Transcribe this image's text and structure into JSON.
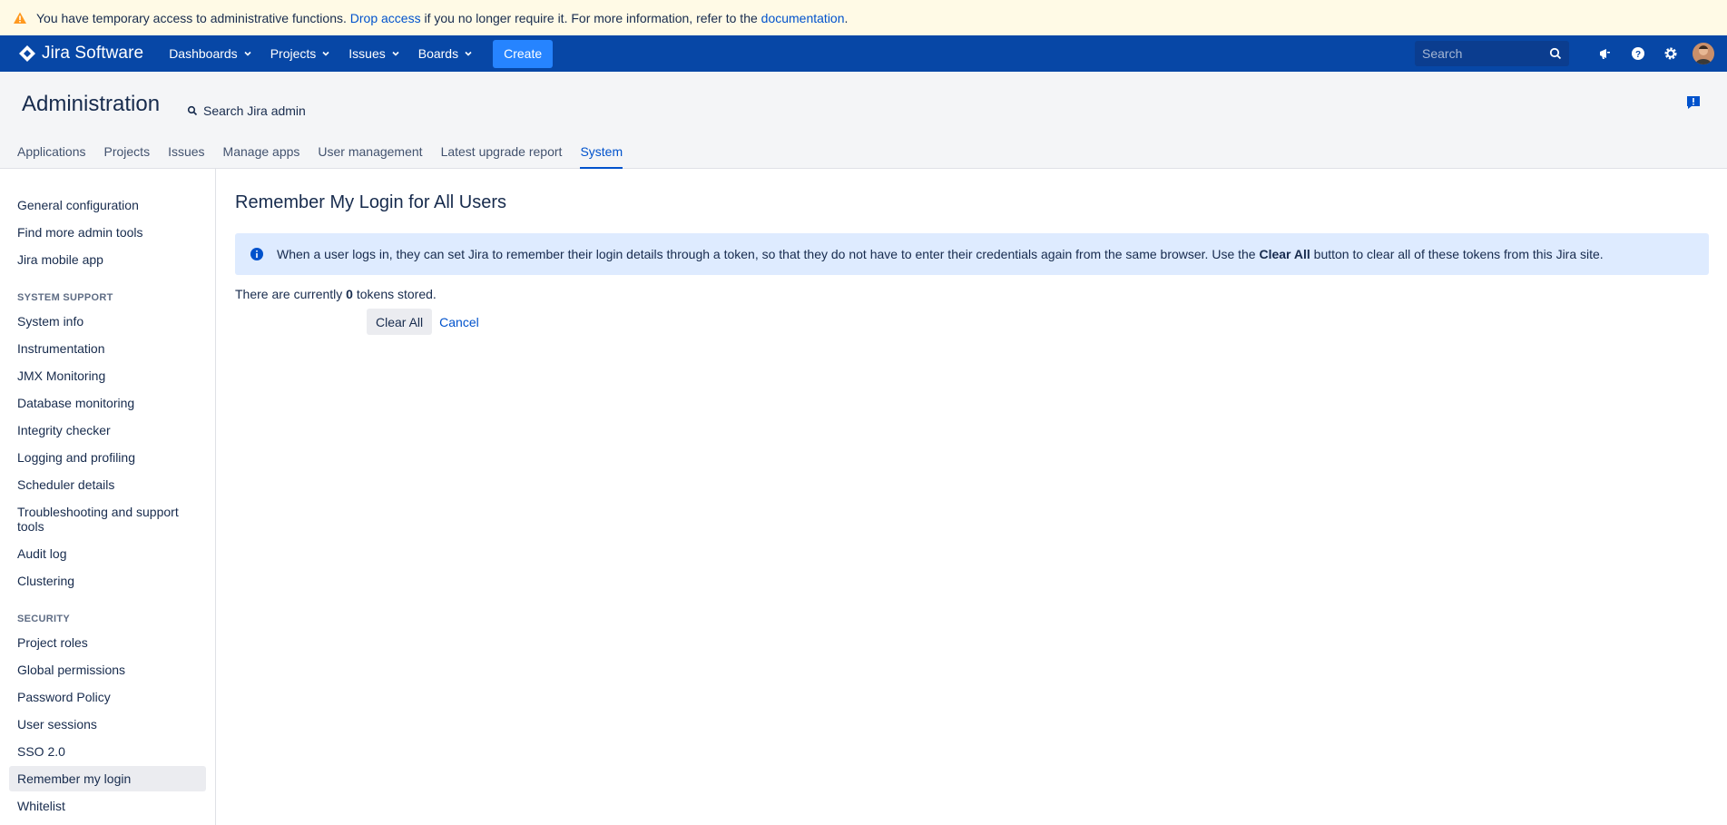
{
  "banner": {
    "text_before": "You have temporary access to administrative functions.",
    "drop_access_link": "Drop access",
    "text_middle": "if you no longer require it. For more information, refer to the",
    "documentation_link": "documentation",
    "text_after": ".",
    "icon": "warning-icon"
  },
  "topnav": {
    "logo_text": "Jira Software",
    "items": [
      {
        "label": "Dashboards"
      },
      {
        "label": "Projects"
      },
      {
        "label": "Issues"
      },
      {
        "label": "Boards"
      }
    ],
    "create_label": "Create",
    "search_placeholder": "Search",
    "icons": [
      "notifications-icon",
      "help-icon",
      "settings-icon"
    ],
    "colors": {
      "bar": "#0747a6",
      "create": "#2684ff"
    }
  },
  "admin": {
    "title": "Administration",
    "search_label": "Search Jira admin",
    "tabs": [
      {
        "label": "Applications"
      },
      {
        "label": "Projects"
      },
      {
        "label": "Issues"
      },
      {
        "label": "Manage apps"
      },
      {
        "label": "User management"
      },
      {
        "label": "Latest upgrade report"
      },
      {
        "label": "System"
      }
    ],
    "active_tab": "System"
  },
  "sidebar": {
    "top_items": [
      {
        "label": "General configuration"
      },
      {
        "label": "Find more admin tools"
      },
      {
        "label": "Jira mobile app"
      }
    ],
    "system_support_heading": "SYSTEM SUPPORT",
    "system_support_items": [
      {
        "label": "System info"
      },
      {
        "label": "Instrumentation"
      },
      {
        "label": "JMX Monitoring"
      },
      {
        "label": "Database monitoring"
      },
      {
        "label": "Integrity checker"
      },
      {
        "label": "Logging and profiling"
      },
      {
        "label": "Scheduler details"
      },
      {
        "label": "Troubleshooting and support tools"
      },
      {
        "label": "Audit log"
      },
      {
        "label": "Clustering"
      }
    ],
    "security_heading": "SECURITY",
    "security_items": [
      {
        "label": "Project roles"
      },
      {
        "label": "Global permissions"
      },
      {
        "label": "Password Policy"
      },
      {
        "label": "User sessions"
      },
      {
        "label": "SSO 2.0"
      },
      {
        "label": "Remember my login"
      },
      {
        "label": "Whitelist"
      }
    ],
    "active_item": "Remember my login"
  },
  "main": {
    "title": "Remember My Login for All Users",
    "info": {
      "text_before": "When a user logs in, they can set Jira to remember their login details through a token, so that they do not have to enter their credentials again from the same browser. Use the",
      "bold": "Clear All",
      "text_after": "button to clear all of these tokens from this Jira site."
    },
    "tokens": {
      "before": "There are currently",
      "count": "0",
      "after": "tokens stored."
    },
    "clear_all_label": "Clear All",
    "cancel_label": "Cancel"
  }
}
